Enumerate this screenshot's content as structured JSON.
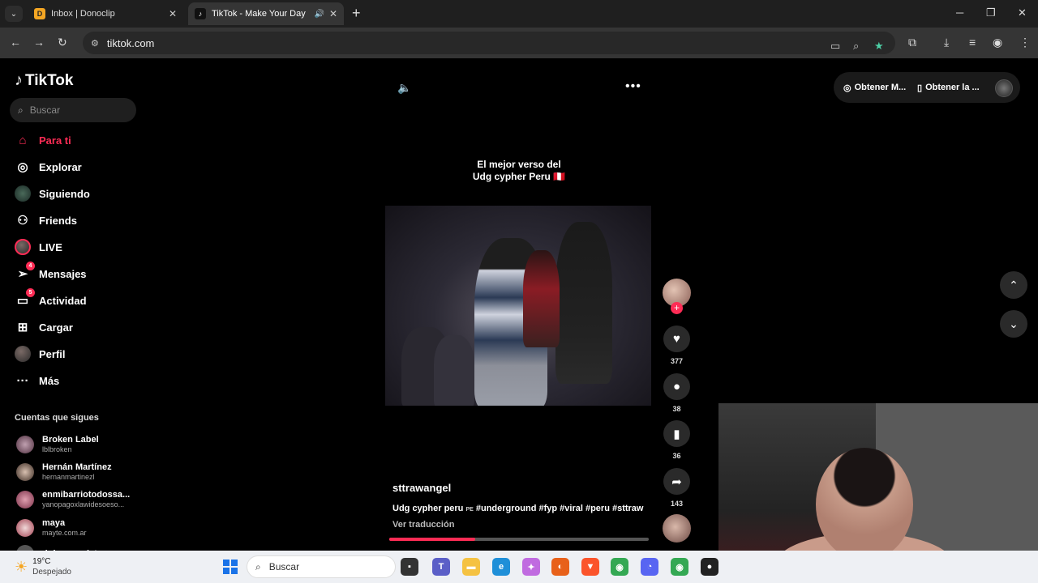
{
  "browser": {
    "tabs": [
      {
        "title": "Inbox | Donoclip",
        "favicon": "donoclip-favicon",
        "active": false
      },
      {
        "title": "TikTok - Make Your Day",
        "favicon": "tiktok-favicon",
        "active": true
      }
    ],
    "url": "tiktok.com"
  },
  "sidebar": {
    "logo": "TikTok",
    "search_placeholder": "Buscar",
    "nav": [
      {
        "label": "Para ti",
        "icon": "home-icon",
        "active": true
      },
      {
        "label": "Explorar",
        "icon": "compass-icon"
      },
      {
        "label": "Siguiendo",
        "icon": "following-avatar-icon"
      },
      {
        "label": "Friends",
        "icon": "friends-icon"
      },
      {
        "label": "LIVE",
        "icon": "live-avatar-icon"
      },
      {
        "label": "Mensajes",
        "icon": "messages-icon",
        "badge": "4"
      },
      {
        "label": "Actividad",
        "icon": "activity-icon",
        "badge": "5"
      },
      {
        "label": "Cargar",
        "icon": "upload-icon"
      },
      {
        "label": "Perfil",
        "icon": "profile-avatar-icon"
      },
      {
        "label": "Más",
        "icon": "more-icon"
      }
    ],
    "following_title": "Cuentas que sigues",
    "following": [
      {
        "name": "Broken Label",
        "handle": "lblbroken"
      },
      {
        "name": "Hernán Martínez",
        "handle": "hernanmartinezl"
      },
      {
        "name": "enmibarriotodossa...",
        "handle": "yanopagoxlawidesoeso..."
      },
      {
        "name": "maya",
        "handle": "mayte.com.ar"
      },
      {
        "name": "dulcecuquista",
        "handle": ""
      }
    ]
  },
  "video": {
    "overlay_line1": "El mejor verso del",
    "overlay_line2": "Udg cypher Peru 🇵🇪",
    "author": "sttrawangel",
    "caption": "Udg cypher peru",
    "caption_flag": "PE",
    "hashtags": "#underground #fyp #viral #peru #sttraw",
    "translate": "Ver traducción",
    "progress": 0.33
  },
  "actions": {
    "likes": "377",
    "comments": "38",
    "saves": "36",
    "shares": "143"
  },
  "header": {
    "get_app_1": "Obtener M...",
    "get_app_2": "Obtener la ..."
  },
  "taskbar": {
    "temperature": "19°C",
    "condition": "Despejado",
    "search_placeholder": "Buscar"
  },
  "colors": {
    "accent": "#fe2c55",
    "background": "#000000"
  }
}
